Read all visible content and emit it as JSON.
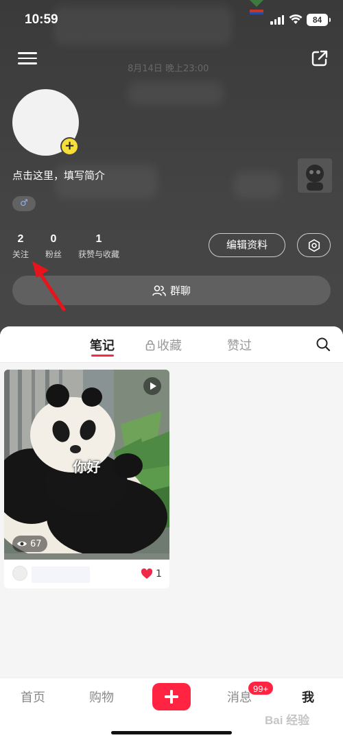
{
  "status_bar": {
    "time": "10:59",
    "battery": "84"
  },
  "background": {
    "date_text": "8月14日 晚上23:00"
  },
  "profile": {
    "avatar_add": "+",
    "bio": "点击这里，填写简介",
    "gender_symbol": "♂",
    "stats": [
      {
        "value": "2",
        "label": "关注"
      },
      {
        "value": "0",
        "label": "粉丝"
      },
      {
        "value": "1",
        "label": "获赞与收藏"
      }
    ],
    "edit_label": "编辑资料",
    "group_chat_label": "群聊"
  },
  "tabs": [
    {
      "label": "笔记",
      "active": true
    },
    {
      "label": "收藏",
      "active": false
    },
    {
      "label": "赞过",
      "active": false
    }
  ],
  "notes": [
    {
      "overlay_text": "你好",
      "views": "67",
      "likes": "1"
    }
  ],
  "bottom_nav": {
    "items": [
      {
        "label": "首页"
      },
      {
        "label": "购物"
      },
      {
        "label": "消息",
        "badge": "99+"
      },
      {
        "label": "我",
        "active": true
      }
    ]
  },
  "watermark": "Bai 经验",
  "colors": {
    "accent": "#ff2442",
    "header_bg": "#444444",
    "avatar_plus": "#f8de38"
  }
}
